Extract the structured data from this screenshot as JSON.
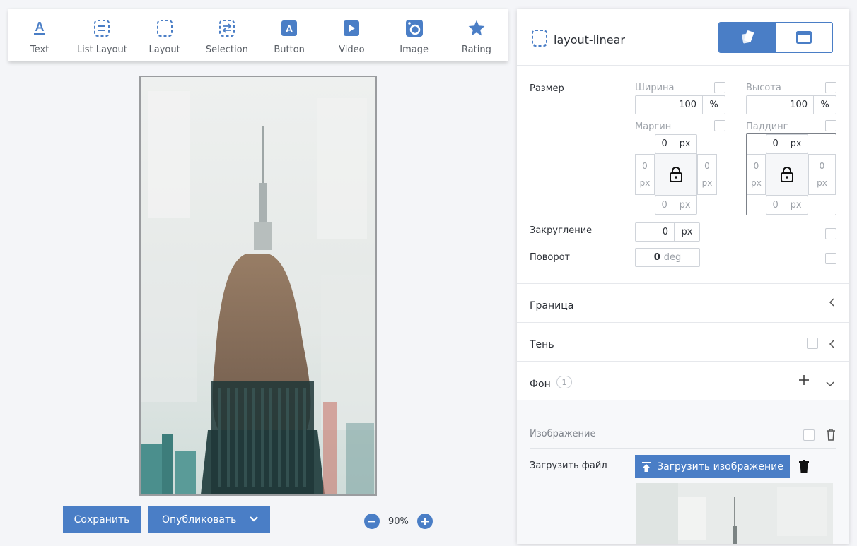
{
  "toolbar": {
    "items": [
      {
        "label": "Text",
        "icon": "text-icon"
      },
      {
        "label": "List Layout",
        "icon": "list-layout-icon"
      },
      {
        "label": "Layout",
        "icon": "layout-icon"
      },
      {
        "label": "Selection",
        "icon": "selection-icon"
      },
      {
        "label": "Button",
        "icon": "button-icon"
      },
      {
        "label": "Video",
        "icon": "video-icon"
      },
      {
        "label": "Image",
        "icon": "image-icon"
      },
      {
        "label": "Rating",
        "icon": "star-icon"
      }
    ]
  },
  "actions": {
    "save": "Сохранить",
    "publish": "Опубликовать",
    "zoom": "90%"
  },
  "panel": {
    "title": "layout-linear",
    "size_label": "Размер",
    "width_label": "Ширина",
    "width_value": "100",
    "width_unit": "%",
    "height_label": "Высота",
    "height_value": "100",
    "height_unit": "%",
    "margin_label": "Маргин",
    "padding_label": "Паддинг",
    "zero": "0",
    "px": "px",
    "radius_label": "Закругление",
    "radius_value": "0",
    "radius_unit": "px",
    "rotation_label": "Поворот",
    "rotation_value": "0",
    "rotation_unit": "deg",
    "border_section": "Граница",
    "shadow_section": "Тень",
    "background_section": "Фон",
    "background_count": "1",
    "image_label": "Изображение",
    "upload_file_label": "Загрузить файл",
    "upload_button": "Загрузить изображение"
  },
  "colors": {
    "accent": "#4a7ec6"
  }
}
